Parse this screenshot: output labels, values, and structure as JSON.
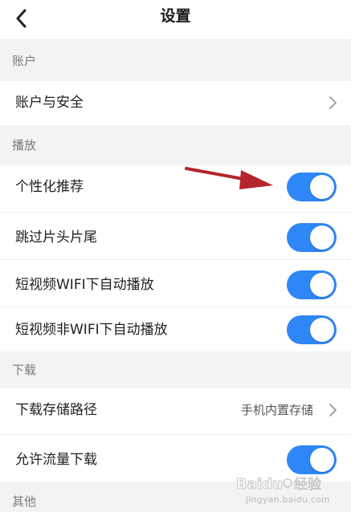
{
  "header": {
    "title": "设置"
  },
  "sections": {
    "account": "账户",
    "playback": "播放",
    "download": "下载",
    "other": "其他"
  },
  "rows": {
    "account_security": "账户与安全",
    "personalized_recommend": "个性化推荐",
    "skip_intro_outro": "跳过片头片尾",
    "short_video_wifi_autoplay": "短视频WIFI下自动播放",
    "short_video_non_wifi_autoplay": "短视频非WIFI下自动播放",
    "download_storage_path": "下载存储路径",
    "download_storage_value": "手机内置存储",
    "allow_cellular_download": "允许流量下载"
  },
  "toggles": {
    "personalized_recommend": true,
    "skip_intro_outro": true,
    "short_video_wifi_autoplay": true,
    "short_video_non_wifi_autoplay": true,
    "allow_cellular_download": true
  },
  "colors": {
    "toggle_on": "#2f86f6",
    "annotation_arrow": "#b3262b",
    "background": "#f2f3f5"
  },
  "watermark": {
    "logo_text": "Baidu 经验",
    "url": "jingyan.baidu.com"
  }
}
